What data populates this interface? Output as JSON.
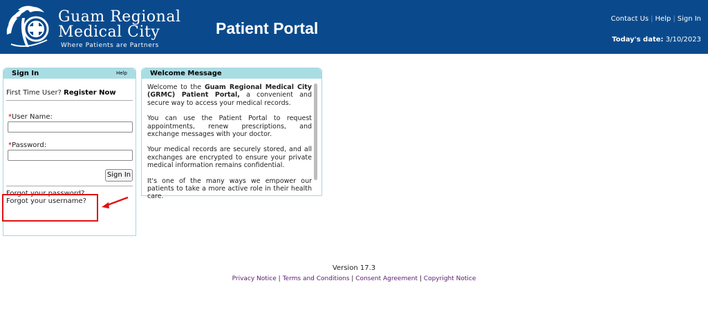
{
  "header": {
    "brand_line1": "Guam Regional",
    "brand_line2": "Medical City",
    "tagline": "Where Patients are Partners",
    "title": "Patient Portal",
    "links": {
      "contact": "Contact Us",
      "help": "Help",
      "signin": "Sign In"
    },
    "today_label": "Today's date:",
    "today_value": "3/10/2023",
    "bg_color": "#0a4a8c"
  },
  "signin_panel": {
    "title": "Sign In",
    "help": "Help",
    "first_time_prefix": "First Time User?",
    "register_link": "Register Now",
    "username_label": "User Name:",
    "password_label": "Password:",
    "username_value": "",
    "password_value": "",
    "required_marker": "*",
    "signin_button": "Sign In",
    "forgot_password": "Forgot your password?",
    "forgot_username": "Forgot your username?"
  },
  "welcome_panel": {
    "title": "Welcome Message",
    "p1_prefix": "Welcome to the",
    "p1_bold": "Guam Regional Medical City (GRMC) Patient Portal,",
    "p1_suffix": "a convenient and secure way to access your medical records.",
    "p2": "You can use the Patient Portal to request appointments, renew prescriptions, and exchange messages with your doctor.",
    "p3": "Your medical records are securely stored, and all exchanges are encrypted to ensure your private medical information remains confidential.",
    "p4": "It's one of the many ways we empower our patients to take a more active role in their health care."
  },
  "footer": {
    "version": "Version 17.3",
    "links": [
      "Privacy Notice",
      "Terms and Conditions",
      "Consent Agreement",
      "Copyright Notice"
    ],
    "separator": "|"
  },
  "annotation": {
    "color": "#e01010"
  }
}
